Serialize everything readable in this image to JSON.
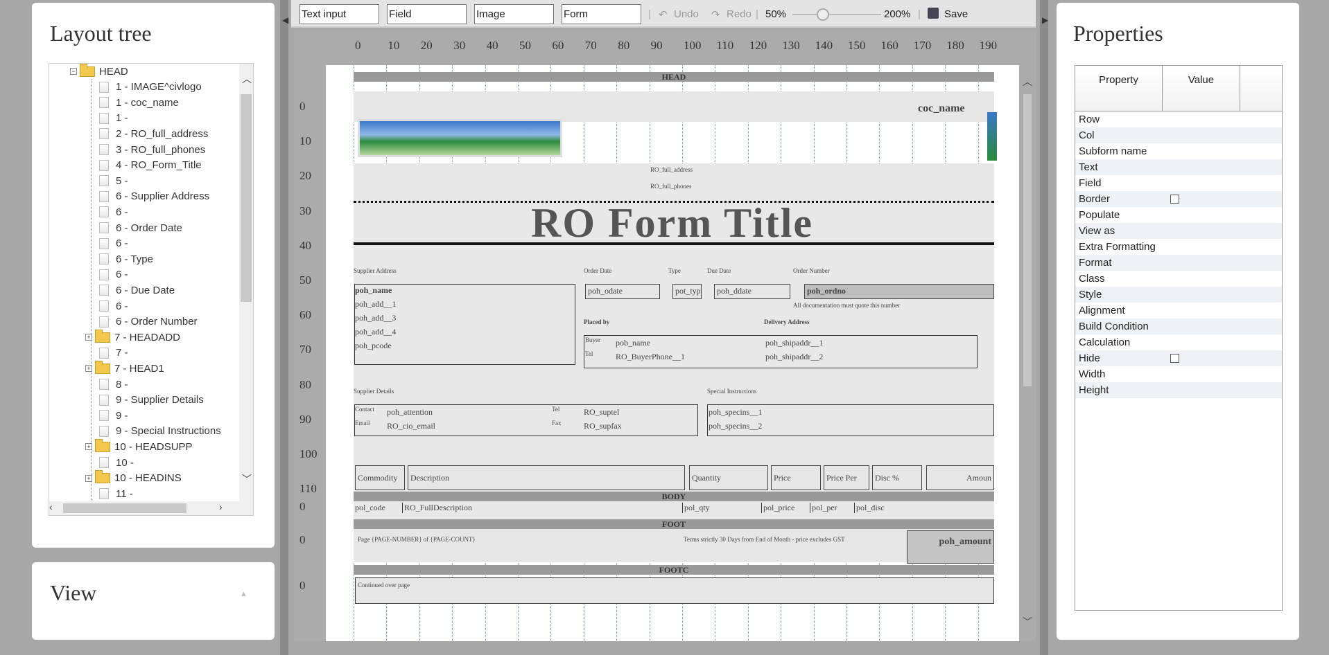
{
  "tree": {
    "title": "Layout tree",
    "items": [
      {
        "label": "HEAD",
        "kind": "folder-open",
        "depth": 0
      },
      {
        "label": "1 - IMAGE^civlogo",
        "kind": "doc",
        "depth": 1
      },
      {
        "label": "1 - coc_name",
        "kind": "doc",
        "depth": 1
      },
      {
        "label": "1 -",
        "kind": "doc",
        "depth": 1
      },
      {
        "label": "2 - RO_full_address",
        "kind": "doc",
        "depth": 1
      },
      {
        "label": "3 - RO_full_phones",
        "kind": "doc",
        "depth": 1
      },
      {
        "label": "4 - RO_Form_Title",
        "kind": "doc",
        "depth": 1
      },
      {
        "label": "5 -",
        "kind": "doc",
        "depth": 1
      },
      {
        "label": "6 - Supplier Address",
        "kind": "doc",
        "depth": 1
      },
      {
        "label": "6 -",
        "kind": "doc",
        "depth": 1
      },
      {
        "label": "6 - Order Date",
        "kind": "doc",
        "depth": 1
      },
      {
        "label": "6 -",
        "kind": "doc",
        "depth": 1
      },
      {
        "label": "6 - Type",
        "kind": "doc",
        "depth": 1
      },
      {
        "label": "6 -",
        "kind": "doc",
        "depth": 1
      },
      {
        "label": "6 - Due Date",
        "kind": "doc",
        "depth": 1
      },
      {
        "label": "6 -",
        "kind": "doc",
        "depth": 1
      },
      {
        "label": "6 - Order Number",
        "kind": "doc",
        "depth": 1
      },
      {
        "label": "7 - HEADADD",
        "kind": "folder",
        "depth": 1
      },
      {
        "label": "7 -",
        "kind": "doc",
        "depth": 1
      },
      {
        "label": "7 - HEAD1",
        "kind": "folder",
        "depth": 1
      },
      {
        "label": "8 -",
        "kind": "doc",
        "depth": 1
      },
      {
        "label": "9 - Supplier Details",
        "kind": "doc",
        "depth": 1
      },
      {
        "label": "9 -",
        "kind": "doc",
        "depth": 1
      },
      {
        "label": "9 - Special Instructions",
        "kind": "doc",
        "depth": 1
      },
      {
        "label": "10 - HEADSUPP",
        "kind": "folder",
        "depth": 1
      },
      {
        "label": "10 -",
        "kind": "doc",
        "depth": 1
      },
      {
        "label": "10 - HEADINS",
        "kind": "folder",
        "depth": 1
      },
      {
        "label": "11 -",
        "kind": "doc",
        "depth": 1
      }
    ]
  },
  "view": {
    "title": "View",
    "toggle": "▲"
  },
  "toolbar": {
    "text_input": "Text input",
    "field": "Field",
    "image": "Image",
    "form": "Form",
    "undo": "Undo",
    "redo": "Redo",
    "zoom_min": "50%",
    "zoom_max": "200%",
    "save": "Save"
  },
  "ruler": {
    "h": [
      "0",
      "10",
      "20",
      "30",
      "40",
      "50",
      "60",
      "70",
      "80",
      "90",
      "100",
      "110",
      "120",
      "130",
      "140",
      "150",
      "160",
      "170",
      "180",
      "190"
    ],
    "v_head": [
      "0",
      "10",
      "20",
      "30",
      "40",
      "50",
      "60",
      "70",
      "80",
      "90",
      "100",
      "110"
    ],
    "v_body": "0",
    "v_foot": "0",
    "v_footc": "0"
  },
  "design": {
    "band_head": "HEAD",
    "band_body": "BODY",
    "band_foot": "FOOT",
    "band_footc": "FOOTC",
    "coc_name": "coc_name",
    "full_address": "RO_full_address",
    "full_phones": "RO_full_phones",
    "form_title": "RO Form Title",
    "supplier_address": "Supplier Address",
    "order_date": "Order Date",
    "type": "Type",
    "due_date": "Due Date",
    "order_number": "Order Number",
    "poh_name": "poh_name",
    "poh_add1": "poh_add__1",
    "poh_add3": "poh_add__3",
    "poh_add4": "poh_add__4",
    "poh_pcode": "poh_pcode",
    "poh_odate": "poh_odate",
    "pot_typ": "pot_typ",
    "poh_ddate": "poh_ddate",
    "poh_ordno": "poh_ordno",
    "quote_note": "All documentation must quote this number",
    "placed_by": "Placed by",
    "delivery_address": "Delivery Address",
    "buyer": "Buyer",
    "pob_name": "pob_name",
    "tel": "Tel",
    "buyer_phone": "RO_BuyerPhone__1",
    "shipaddr1": "poh_shipaddr__1",
    "shipaddr2": "poh_shipaddr__2",
    "supplier_details": "Supplier Details",
    "special_instructions": "Special Instructions",
    "contact": "Contact",
    "poh_attention": "poh_attention",
    "tel2": "Tel",
    "ro_suptel": "RO_suptel",
    "email": "Email",
    "ro_cio_email": "RO_cio_email",
    "fax": "Fax",
    "ro_supfax": "RO_supfax",
    "specins1": "poh_specins__1",
    "specins2": "poh_specins__2",
    "col_commodity": "Commodity",
    "col_description": "Description",
    "col_quantity": "Quantity",
    "col_price": "Price",
    "col_price_per": "Price Per",
    "col_disc": "Disc %",
    "col_amount": "Amoun",
    "pol_code": "pol_code",
    "ro_fulldesc": "RO_FullDescription",
    "pol_qty": "pol_qty",
    "pol_price": "pol_price",
    "pol_per": "pol_per",
    "pol_disc": "pol_disc",
    "page_number": "Page {PAGE-NUMBER} of {PAGE-COUNT}",
    "terms": "Terms strictly 30 Days from End of Month - price excludes GST",
    "poh_amount": "poh_amount",
    "continued": "Continued over page"
  },
  "properties": {
    "title": "Properties",
    "col_property": "Property",
    "col_value": "Value",
    "rows": [
      "Row",
      "Col",
      "Subform name",
      "Text",
      "Field",
      "Border",
      "Populate",
      "View as",
      "Extra Formatting",
      "Format",
      "Class",
      "Style",
      "Alignment",
      "Build Condition",
      "Calculation",
      "Hide",
      "Width",
      "Height"
    ]
  }
}
